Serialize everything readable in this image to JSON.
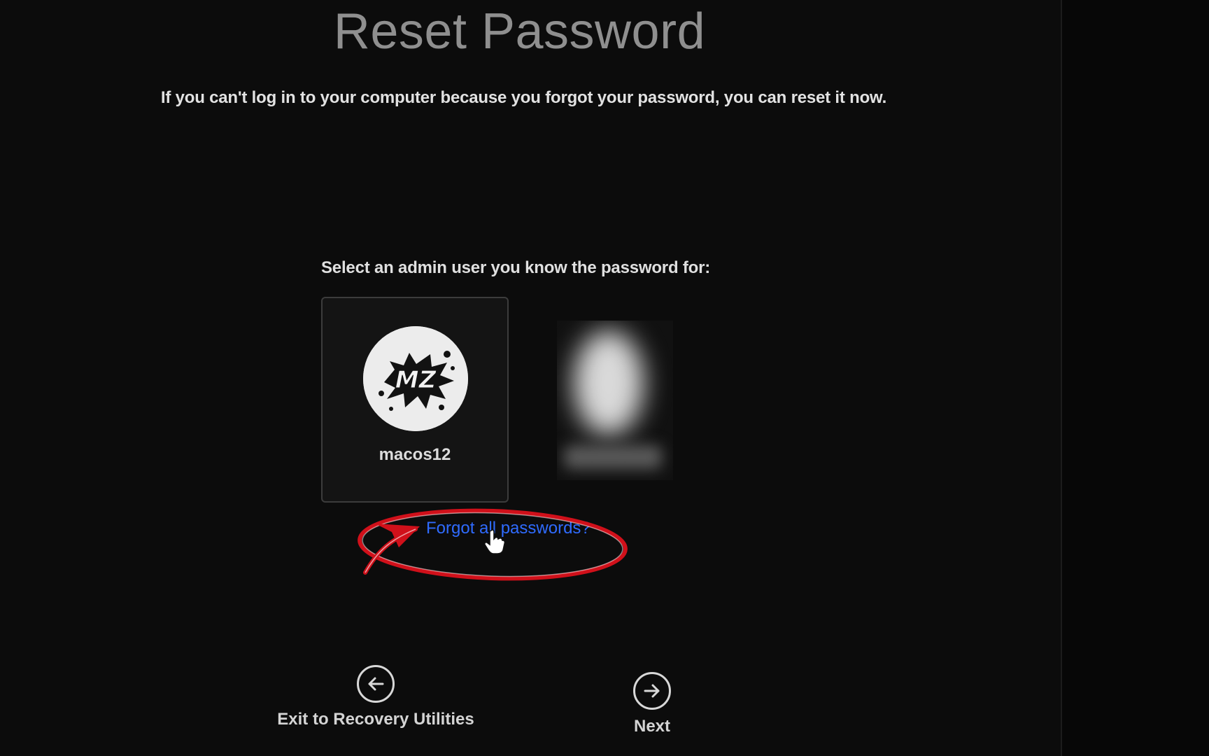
{
  "page": {
    "title": "Reset Password",
    "description": "If you can't log in to your computer because you forgot your password, you can reset it now."
  },
  "user_selection": {
    "label": "Select an admin user you know the password for:",
    "users": [
      {
        "name": "macos12",
        "avatar_text": "MZ",
        "avatar_icon": "splatter-logo-icon"
      },
      {
        "name": "",
        "avatar_icon": "blurred-user-icon"
      }
    ]
  },
  "links": {
    "forgot_all_passwords": "Forgot all passwords?"
  },
  "footer": {
    "exit_label": "Exit to Recovery Utilities",
    "exit_icon": "arrow-left-circle-icon",
    "next_label": "Next",
    "next_icon": "arrow-right-circle-icon"
  },
  "colors": {
    "background": "#0c0c0c",
    "title": "#8f8f8f",
    "link": "#2f6bff",
    "annotation": "#d0101a"
  }
}
